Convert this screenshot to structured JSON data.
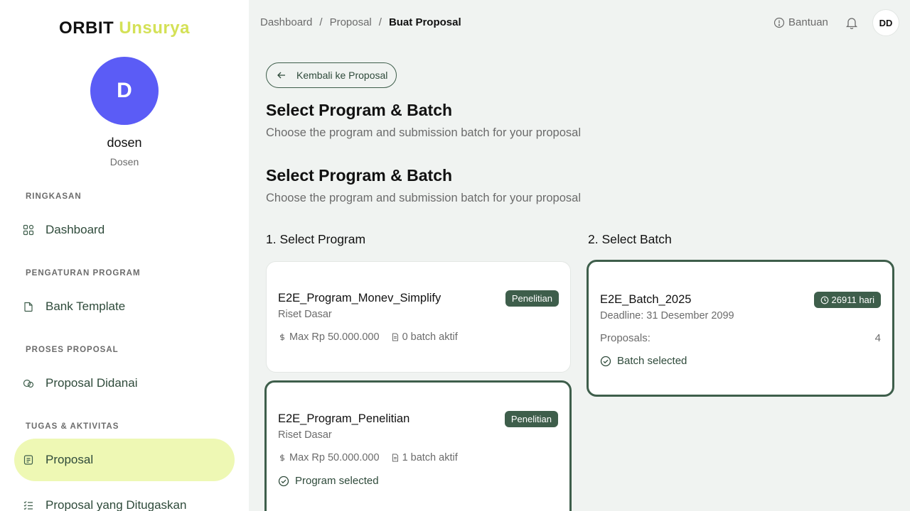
{
  "brand": {
    "part1": "ORBIT",
    "part2": "Unsurya"
  },
  "user": {
    "initial": "D",
    "name": "dosen",
    "role": "Dosen",
    "initials": "DD"
  },
  "sidebar": {
    "sections": [
      {
        "title": "RINGKASAN",
        "items": [
          {
            "label": "Dashboard",
            "icon": "grid-icon"
          }
        ]
      },
      {
        "title": "PENGATURAN PROGRAM",
        "items": [
          {
            "label": "Bank Template",
            "icon": "file-icon"
          }
        ]
      },
      {
        "title": "PROSES PROPOSAL",
        "items": [
          {
            "label": "Proposal Didanai",
            "icon": "coins-icon"
          }
        ]
      },
      {
        "title": "TUGAS & AKTIVITAS",
        "items": [
          {
            "label": "Proposal",
            "icon": "document-icon",
            "active": true
          },
          {
            "label": "Proposal yang Ditugaskan",
            "icon": "checklist-icon"
          }
        ]
      }
    ]
  },
  "breadcrumb": {
    "items": [
      "Dashboard",
      "Proposal",
      "Buat Proposal"
    ],
    "separator": "/"
  },
  "topbar": {
    "help_label": "Bantuan"
  },
  "back_button": {
    "label": "Kembali ke Proposal"
  },
  "headers": [
    {
      "title": "Select Program & Batch",
      "subtitle": "Choose the program and submission batch for your proposal"
    },
    {
      "title": "Select Program & Batch",
      "subtitle": "Choose the program and submission batch for your proposal"
    }
  ],
  "program_column": {
    "title": "1. Select Program",
    "programs": [
      {
        "name": "E2E_Program_Monev_Simplify",
        "type": "Riset Dasar",
        "badge": "Penelitian",
        "max": "Max Rp 50.000.000",
        "batches": "0 batch aktif",
        "selected": false
      },
      {
        "name": "E2E_Program_Penelitian",
        "type": "Riset Dasar",
        "badge": "Penelitian",
        "max": "Max Rp 50.000.000",
        "batches": "1 batch aktif",
        "selected": true,
        "selected_label": "Program selected"
      }
    ]
  },
  "batch_column": {
    "title": "2. Select Batch",
    "batch": {
      "name": "E2E_Batch_2025",
      "badge": "26911 hari",
      "deadline": "Deadline: 31 Desember 2099",
      "proposals_label": "Proposals:",
      "proposals_count": "4",
      "selected_label": "Batch selected"
    }
  },
  "colors": {
    "accent": "#3e5e4b",
    "active_nav": "#eef8b4",
    "avatar": "#5b5cf6",
    "brand_highlight": "#d4e157"
  }
}
